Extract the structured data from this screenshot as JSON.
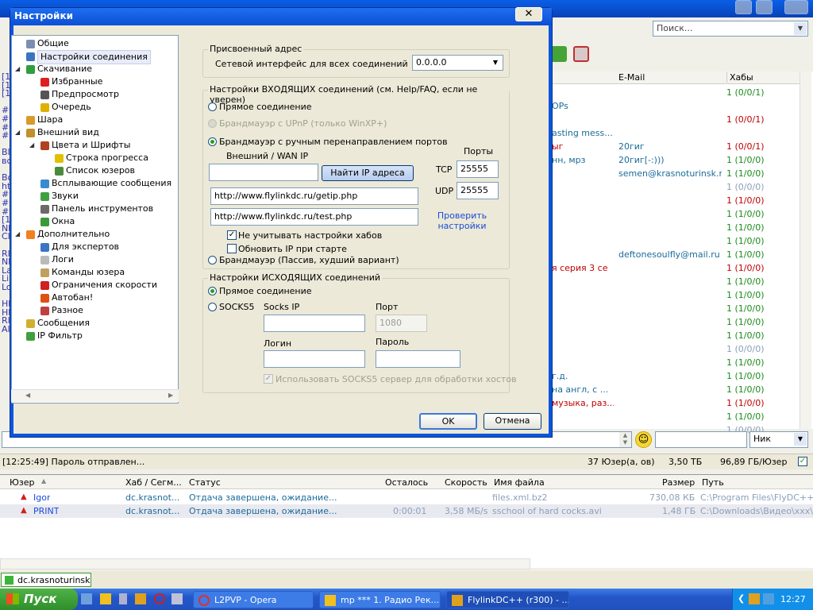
{
  "app": {
    "search_placeholder": "Поиск...",
    "userlist_headers": [
      "E-Mail",
      "Хабы"
    ],
    "userlist_rows": [
      {
        "desc": "",
        "email": "",
        "hubs": "1 (0/0/1)",
        "hubs_color": "#1a8a1a",
        "desc_color": "#000"
      },
      {
        "desc": "OPs",
        "email": "",
        "hubs": "",
        "hubs_color": "#1a8a1a",
        "desc_color": "#1b6b9a"
      },
      {
        "desc": "",
        "email": "",
        "hubs": "1 (0/0/1)",
        "hubs_color": "#c00000",
        "desc_color": "#000"
      },
      {
        "desc": "asting mess...",
        "email": "",
        "hubs": "",
        "hubs_color": "#1a8a1a",
        "desc_color": "#1b6b9a"
      },
      {
        "desc": "ыг",
        "email": "20гиг",
        "hubs": "1 (0/0/1)",
        "hubs_color": "#c00000",
        "desc_color": "#c00000"
      },
      {
        "desc": "нн, мрз",
        "email": "20гиг[-:)))",
        "hubs": "1 (1/0/0)",
        "hubs_color": "#1a8a1a",
        "desc_color": "#1b6b9a"
      },
      {
        "desc": "",
        "email": "semen@krasnoturinsk.ru",
        "hubs": "1 (1/0/0)",
        "hubs_color": "#1a8a1a",
        "desc_color": "#000"
      },
      {
        "desc": "",
        "email": "",
        "hubs": "1 (0/0/0)",
        "hubs_color": "#8aa0b8",
        "desc_color": "#000"
      },
      {
        "desc": "",
        "email": "",
        "hubs": "1 (1/0/0)",
        "hubs_color": "#c00000",
        "desc_color": "#000"
      },
      {
        "desc": "",
        "email": "",
        "hubs": "1 (1/0/0)",
        "hubs_color": "#1a8a1a",
        "desc_color": "#000"
      },
      {
        "desc": "",
        "email": "",
        "hubs": "1 (1/0/0)",
        "hubs_color": "#1a8a1a",
        "desc_color": "#000"
      },
      {
        "desc": "",
        "email": "",
        "hubs": "1 (1/0/0)",
        "hubs_color": "#1a8a1a",
        "desc_color": "#000"
      },
      {
        "desc": "",
        "email": "deftonesoulfly@mail.ru",
        "hubs": "1 (1/0/0)",
        "hubs_color": "#1a8a1a",
        "desc_color": "#000"
      },
      {
        "desc": "я серия 3 се",
        "email": "",
        "hubs": "1 (1/0/0)",
        "hubs_color": "#c00000",
        "desc_color": "#c00000"
      },
      {
        "desc": "",
        "email": "",
        "hubs": "1 (1/0/0)",
        "hubs_color": "#1a8a1a",
        "desc_color": "#000"
      },
      {
        "desc": "",
        "email": "",
        "hubs": "1 (1/0/0)",
        "hubs_color": "#1a8a1a",
        "desc_color": "#000"
      },
      {
        "desc": "",
        "email": "",
        "hubs": "1 (1/0/0)",
        "hubs_color": "#1a8a1a",
        "desc_color": "#000"
      },
      {
        "desc": "",
        "email": "",
        "hubs": "1 (1/0/0)",
        "hubs_color": "#1a8a1a",
        "desc_color": "#000"
      },
      {
        "desc": "",
        "email": "",
        "hubs": "1 (1/0/0)",
        "hubs_color": "#1a8a1a",
        "desc_color": "#000"
      },
      {
        "desc": "",
        "email": "",
        "hubs": "1 (0/0/0)",
        "hubs_color": "#8aa0b8",
        "desc_color": "#000"
      },
      {
        "desc": "",
        "email": "",
        "hubs": "1 (1/0/0)",
        "hubs_color": "#1a8a1a",
        "desc_color": "#000"
      },
      {
        "desc": "г.д.",
        "email": "",
        "hubs": "1 (1/0/0)",
        "hubs_color": "#1a8a1a",
        "desc_color": "#1b6b9a"
      },
      {
        "desc": "на англ, с ...",
        "email": "",
        "hubs": "1 (1/0/0)",
        "hubs_color": "#1a8a1a",
        "desc_color": "#1b6b9a"
      },
      {
        "desc": "музыка, раз...",
        "email": "",
        "hubs": "1 (1/0/0)",
        "hubs_color": "#c00000",
        "desc_color": "#c00000"
      },
      {
        "desc": "",
        "email": "",
        "hubs": "1 (1/0/0)",
        "hubs_color": "#1a8a1a",
        "desc_color": "#000"
      },
      {
        "desc": "",
        "email": "",
        "hubs": "1 (0/0/0)",
        "hubs_color": "#8aa0b8",
        "desc_color": "#000"
      }
    ],
    "nick_select": "Ник",
    "status": {
      "message": "[12:25:49] Пароль отправлен...",
      "users": "37 Юзер(а, ов)",
      "share": "3,50 ТБ",
      "per_user": "96,89 ГБ/Юзер"
    },
    "transfers": {
      "headers": [
        "Юзер",
        "Хаб / Сегм...",
        "Статус",
        "Осталось",
        "Скорость",
        "Имя файла",
        "Размер",
        "Путь"
      ],
      "rows": [
        {
          "user": "Igor",
          "hub": "dc.krasnot...",
          "status": "Отдача завершена, ожидание...",
          "left": "",
          "speed": "",
          "file": "files.xml.bz2",
          "size": "730,08 КБ",
          "path": "C:\\Program Files\\FlyDC++\\Se"
        },
        {
          "user": "PRINT",
          "hub": "dc.krasnot...",
          "status": "Отдача завершена, ожидание...",
          "left": "0:00:01",
          "speed": "3,58 МБ/s",
          "file": "sschool of hard cocks.avi",
          "size": "1,48 ГБ",
          "path": "C:\\Downloads\\Видео\\xxx\\"
        }
      ]
    },
    "hub_tab": "dc.krasnoturinsk...",
    "left_strip": [
      "[1",
      "[1",
      "[1",
      "",
      "#1",
      "##",
      "#1",
      "##",
      "",
      "Bl",
      "вс",
      "",
      "Bo",
      "ht",
      "##",
      "#1",
      "##",
      "[1",
      "Nl",
      "Cl",
      "",
      "Rl",
      "Nl",
      "La",
      "Li",
      "Lo",
      "",
      "Hl",
      "Hl",
      "Rl",
      "Al"
    ]
  },
  "taskbar": {
    "start": "Пуск",
    "tasks": [
      "L2PVP - Opera",
      "mp *** 1. Радио Рек...",
      "FlylinkDC++ (r300) - ..."
    ],
    "clock": "12:27"
  },
  "dialog": {
    "title": "Настройки",
    "close": "✕",
    "tree": [
      {
        "label": "Общие",
        "depth": 1,
        "icon": "blue-gear-icon",
        "color": "#7a8fb0",
        "expand": "",
        "selected": false
      },
      {
        "label": "Настройки соединения",
        "depth": 1,
        "icon": "network-icon",
        "color": "#3a75c4",
        "expand": "",
        "selected": true
      },
      {
        "label": "Скачивание",
        "depth": 1,
        "icon": "download-icon",
        "color": "#2f9e3f",
        "expand": "◢",
        "selected": false
      },
      {
        "label": "Избранные",
        "depth": 2,
        "icon": "heart-icon",
        "color": "#e02020",
        "expand": "",
        "selected": false
      },
      {
        "label": "Предпросмотр",
        "depth": 2,
        "icon": "preview-icon",
        "color": "#555",
        "expand": "",
        "selected": false
      },
      {
        "label": "Очередь",
        "depth": 2,
        "icon": "queue-icon",
        "color": "#e0b000",
        "expand": "",
        "selected": false
      },
      {
        "label": "Шара",
        "depth": 1,
        "icon": "share-icon",
        "color": "#d89a2a",
        "expand": "",
        "selected": false
      },
      {
        "label": "Внешний вид",
        "depth": 1,
        "icon": "appearance-icon",
        "color": "#c0902a",
        "expand": "◢",
        "selected": false
      },
      {
        "label": "Цвета и Шрифты",
        "depth": 2,
        "icon": "palette-icon",
        "color": "#b04020",
        "expand": "◢",
        "selected": false
      },
      {
        "label": "Строка прогресса",
        "depth": 3,
        "icon": "progress-icon",
        "color": "#e0c000",
        "expand": "",
        "selected": false
      },
      {
        "label": "Список юзеров",
        "depth": 3,
        "icon": "userlist-icon",
        "color": "#4a8a3a",
        "expand": "",
        "selected": false
      },
      {
        "label": "Всплывающие сообщения",
        "depth": 2,
        "icon": "popup-icon",
        "color": "#3a8ad0",
        "expand": "",
        "selected": false
      },
      {
        "label": "Звуки",
        "depth": 2,
        "icon": "sound-icon",
        "color": "#40a040",
        "expand": "",
        "selected": false
      },
      {
        "label": "Панель инструментов",
        "depth": 2,
        "icon": "toolbar-icon",
        "color": "#6a6a6a",
        "expand": "",
        "selected": false
      },
      {
        "label": "Окна",
        "depth": 2,
        "icon": "windows-icon",
        "color": "#3a9a3a",
        "expand": "",
        "selected": false
      },
      {
        "label": "Дополнительно",
        "depth": 1,
        "icon": "advanced-icon",
        "color": "#f08020",
        "expand": "◢",
        "selected": false
      },
      {
        "label": "Для экспертов",
        "depth": 2,
        "icon": "expert-icon",
        "color": "#3a75c4",
        "expand": "",
        "selected": false
      },
      {
        "label": "Логи",
        "depth": 2,
        "icon": "log-icon",
        "color": "#bbb",
        "expand": "",
        "selected": false
      },
      {
        "label": "Команды юзера",
        "depth": 2,
        "icon": "command-icon",
        "color": "#c0a060",
        "expand": "",
        "selected": false
      },
      {
        "label": "Ограничения скорости",
        "depth": 2,
        "icon": "speed-limit-icon",
        "color": "#d02020",
        "expand": "",
        "selected": false
      },
      {
        "label": "Автобан!",
        "depth": 2,
        "icon": "autoban-icon",
        "color": "#e05010",
        "expand": "",
        "selected": false
      },
      {
        "label": "Разное",
        "depth": 2,
        "icon": "misc-icon",
        "color": "#c04040",
        "expand": "",
        "selected": false
      },
      {
        "label": "Сообщения",
        "depth": 1,
        "icon": "messages-icon",
        "color": "#d0b030",
        "expand": "",
        "selected": false
      },
      {
        "label": "IP Фильтр",
        "depth": 1,
        "icon": "ip-filter-icon",
        "color": "#40a040",
        "expand": "",
        "selected": false
      }
    ],
    "assigned": {
      "title": "Присвоенный адрес",
      "iface_label": "Сетевой интерфейс для всех соединений",
      "iface_value": "0.0.0.0"
    },
    "incoming": {
      "title": "Настройки ВХОДЯЩИХ соединений (см. Help/FAQ, если не уверен)",
      "direct": "Прямое соединение",
      "upnp": "Брандмауэр с UPnP (только WinXP+)",
      "manual": "Брандмауэр с ручным перенаправлением портов",
      "wan_label": "Внешний / WAN IP",
      "wan_value": "",
      "find_ip": "Найти IP адреса",
      "ports_label": "Порты",
      "tcp_label": "TCP",
      "tcp_value": "25555",
      "udp_label": "UDP",
      "udp_value": "25555",
      "url1": "http://www.flylinkdc.ru/getip.php",
      "url2": "http://www.flylinkdc.ru/test.php",
      "check_link": "Проверить настройки",
      "ignore_hubs": "Не учитывать настройки хабов",
      "update_ip": "Обновить IP при старте",
      "passive": "Брандмауэр (Пассив, худший вариант)"
    },
    "outgoing": {
      "title": "Настройки ИСХОДЯЩИХ соединений",
      "direct": "Прямое соединение",
      "socks5": "SOCKS5",
      "socks_ip_label": "Socks IP",
      "port_label": "Порт",
      "port_value": "1080",
      "login_label": "Логин",
      "password_label": "Пароль",
      "use_socks": "Использовать SOCKS5 сервер для обработки хостов"
    },
    "ok": "OK",
    "cancel": "Отмена"
  }
}
